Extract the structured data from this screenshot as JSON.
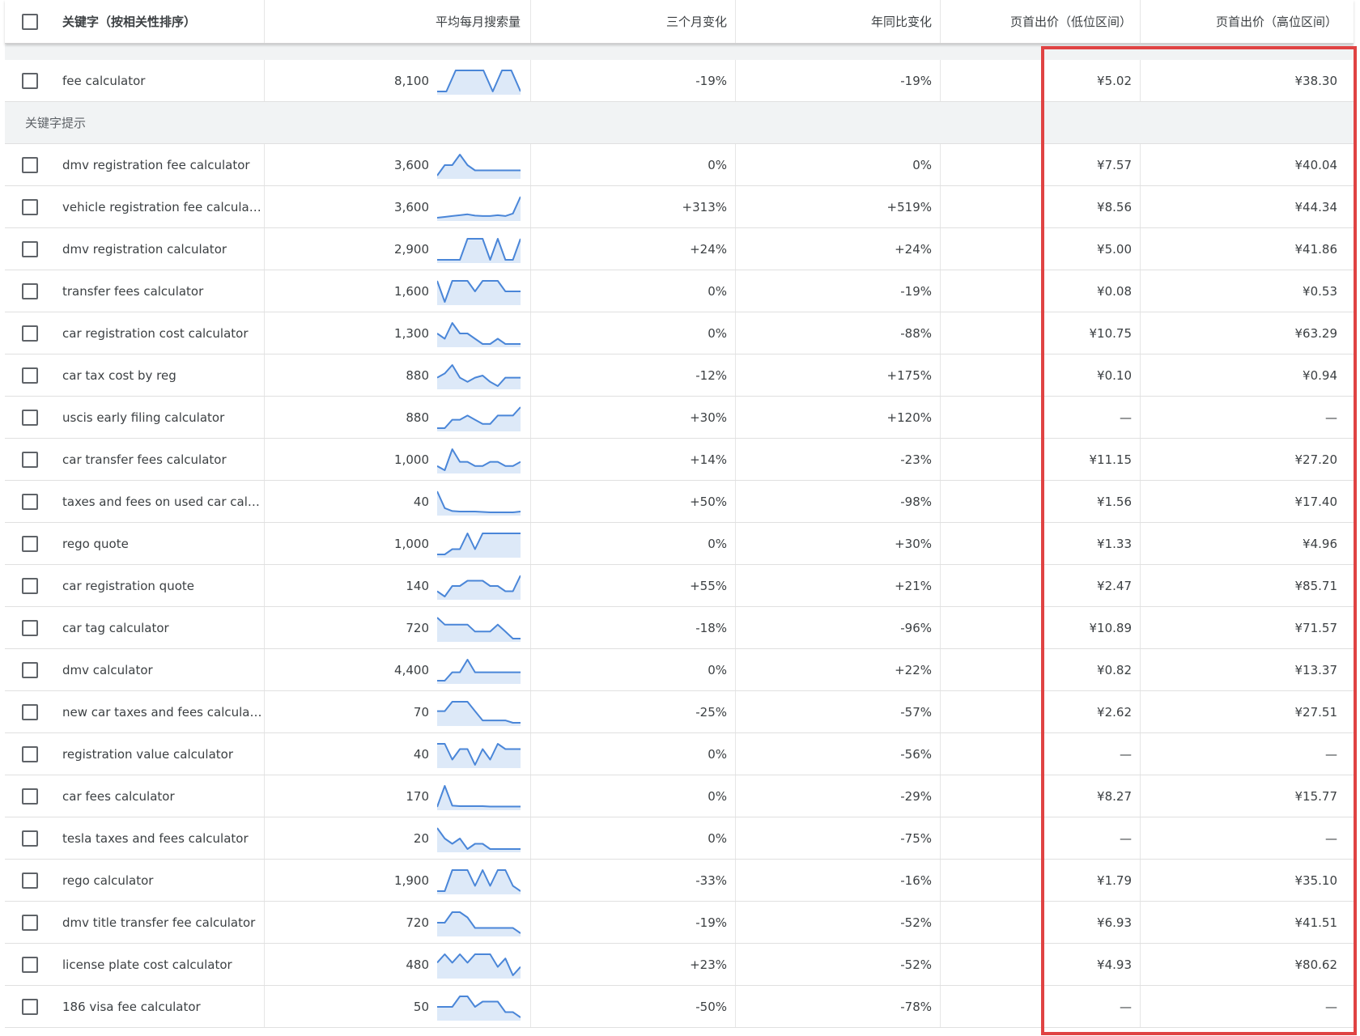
{
  "header": {
    "keyword": "关键字（按相关性排序）",
    "avg_monthly": "平均每月搜索量",
    "three_month": "三个月变化",
    "yoy": "年同比变化",
    "bid_low": "页首出价（低位区间）",
    "bid_high": "页首出价（高位区间）"
  },
  "provided": [
    {
      "keyword": "fee calculator",
      "volume": "8,100",
      "trend": [
        1,
        1,
        6,
        6,
        6,
        6,
        1,
        6,
        6,
        1
      ],
      "three_month": "-19%",
      "yoy": "-19%",
      "bid_low": "¥5.02",
      "bid_high": "¥38.30"
    }
  ],
  "section_label": "关键字提示",
  "rows": [
    {
      "keyword": "dmv registration fee calculator",
      "volume": "3,600",
      "trend": [
        1,
        3,
        3,
        5,
        3,
        2,
        2,
        2,
        2,
        2,
        2,
        2
      ],
      "three_month": "0%",
      "yoy": "0%",
      "bid_low": "¥7.57",
      "bid_high": "¥40.04"
    },
    {
      "keyword": "vehicle registration fee calculator",
      "volume": "3,600",
      "trend": [
        1,
        1.2,
        1.4,
        1.6,
        1.8,
        1.5,
        1.4,
        1.4,
        1.6,
        1.4,
        2,
        6
      ],
      "three_month": "+313%",
      "yoy": "+519%",
      "bid_low": "¥8.56",
      "bid_high": "¥44.34"
    },
    {
      "keyword": "dmv registration calculator",
      "volume": "2,900",
      "trend": [
        1,
        1,
        1,
        1,
        6,
        6,
        6,
        1,
        6,
        1,
        1,
        6
      ],
      "three_month": "+24%",
      "yoy": "+24%",
      "bid_low": "¥5.00",
      "bid_high": "¥41.86"
    },
    {
      "keyword": "transfer fees calculator",
      "volume": "1,600",
      "trend": [
        5,
        1,
        5,
        5,
        5,
        3,
        5,
        5,
        5,
        3,
        3,
        3
      ],
      "three_month": "0%",
      "yoy": "-19%",
      "bid_low": "¥0.08",
      "bid_high": "¥0.53"
    },
    {
      "keyword": "car registration cost calculator",
      "volume": "1,300",
      "trend": [
        4,
        3,
        6,
        4,
        4,
        3,
        2,
        2,
        3,
        2,
        2,
        2
      ],
      "three_month": "0%",
      "yoy": "-88%",
      "bid_low": "¥10.75",
      "bid_high": "¥63.29"
    },
    {
      "keyword": "car tax cost by reg",
      "volume": "880",
      "trend": [
        3,
        4,
        6,
        3,
        2,
        3,
        3.5,
        2,
        1,
        3,
        3,
        3
      ],
      "three_month": "-12%",
      "yoy": "+175%",
      "bid_low": "¥0.10",
      "bid_high": "¥0.94"
    },
    {
      "keyword": "uscis early filing calculator",
      "volume": "880",
      "trend": [
        1,
        1,
        3,
        3,
        4,
        3,
        2,
        2,
        4,
        4,
        4,
        6
      ],
      "three_month": "+30%",
      "yoy": "+120%",
      "bid_low": "—",
      "bid_high": "—"
    },
    {
      "keyword": "car transfer fees calculator",
      "volume": "1,000",
      "trend": [
        2,
        1,
        6,
        3,
        3,
        2,
        2,
        3,
        3,
        2,
        2,
        3
      ],
      "three_month": "+14%",
      "yoy": "-23%",
      "bid_low": "¥11.15",
      "bid_high": "¥27.20"
    },
    {
      "keyword": "taxes and fees on used car calc...",
      "volume": "40",
      "trend": [
        6,
        2,
        1.3,
        1.2,
        1.2,
        1.2,
        1.1,
        1,
        1,
        1,
        1,
        1.2
      ],
      "three_month": "+50%",
      "yoy": "-98%",
      "bid_low": "¥1.56",
      "bid_high": "¥17.40"
    },
    {
      "keyword": "rego quote",
      "volume": "1,000",
      "trend": [
        1,
        1,
        2,
        2,
        5,
        2,
        5,
        5,
        5,
        5,
        5,
        5
      ],
      "three_month": "0%",
      "yoy": "+30%",
      "bid_low": "¥1.33",
      "bid_high": "¥4.96"
    },
    {
      "keyword": "car registration quote",
      "volume": "140",
      "trend": [
        2,
        1,
        3,
        3,
        4,
        4,
        4,
        3,
        3,
        2,
        2,
        5
      ],
      "three_month": "+55%",
      "yoy": "+21%",
      "bid_low": "¥2.47",
      "bid_high": "¥85.71"
    },
    {
      "keyword": "car tag calculator",
      "volume": "720",
      "trend": [
        6,
        5,
        5,
        5,
        5,
        4,
        4,
        4,
        5,
        4,
        3,
        3
      ],
      "three_month": "-18%",
      "yoy": "-96%",
      "bid_low": "¥10.89",
      "bid_high": "¥71.57"
    },
    {
      "keyword": "dmv calculator",
      "volume": "4,400",
      "trend": [
        1,
        1,
        3,
        3,
        6,
        3,
        3,
        3,
        3,
        3,
        3,
        3
      ],
      "three_month": "0%",
      "yoy": "+22%",
      "bid_low": "¥0.82",
      "bid_high": "¥13.37"
    },
    {
      "keyword": "new car taxes and fees calculator",
      "volume": "70",
      "trend": [
        4,
        4,
        6,
        6,
        6,
        4,
        2,
        2,
        2,
        2,
        1.5,
        1.5
      ],
      "three_month": "-25%",
      "yoy": "-57%",
      "bid_low": "¥2.62",
      "bid_high": "¥27.51"
    },
    {
      "keyword": "registration value calculator",
      "volume": "40",
      "trend": [
        5,
        5,
        2,
        4,
        4,
        1,
        4,
        2,
        5,
        4,
        4,
        4
      ],
      "three_month": "0%",
      "yoy": "-56%",
      "bid_low": "—",
      "bid_high": "—"
    },
    {
      "keyword": "car fees calculator",
      "volume": "170",
      "trend": [
        1,
        6,
        1.3,
        1.2,
        1.2,
        1.2,
        1.2,
        1.1,
        1.1,
        1.1,
        1.1,
        1.1
      ],
      "three_month": "0%",
      "yoy": "-29%",
      "bid_low": "¥8.27",
      "bid_high": "¥15.77"
    },
    {
      "keyword": "tesla taxes and fees calculator",
      "volume": "20",
      "trend": [
        5,
        3,
        2,
        3,
        1,
        2,
        2,
        1,
        1,
        1,
        1,
        1
      ],
      "three_month": "0%",
      "yoy": "-75%",
      "bid_low": "—",
      "bid_high": "—"
    },
    {
      "keyword": "rego calculator",
      "volume": "1,900",
      "trend": [
        1,
        1,
        5,
        5,
        5,
        2,
        5,
        2,
        5,
        5,
        2,
        1
      ],
      "three_month": "-33%",
      "yoy": "-16%",
      "bid_low": "¥1.79",
      "bid_high": "¥35.10"
    },
    {
      "keyword": "dmv title transfer fee calculator",
      "volume": "720",
      "trend": [
        3,
        3,
        5,
        5,
        4,
        2,
        2,
        2,
        2,
        2,
        2,
        1
      ],
      "three_month": "-19%",
      "yoy": "-52%",
      "bid_low": "¥6.93",
      "bid_high": "¥41.51"
    },
    {
      "keyword": "license plate cost calculator",
      "volume": "480",
      "trend": [
        4,
        6,
        4,
        6,
        4,
        6,
        6,
        6,
        3,
        5,
        1,
        3
      ],
      "three_month": "+23%",
      "yoy": "-52%",
      "bid_low": "¥4.93",
      "bid_high": "¥80.62"
    },
    {
      "keyword": "186 visa fee calculator",
      "volume": "50",
      "trend": [
        3,
        3,
        3,
        5,
        5,
        3,
        4,
        4,
        4,
        2,
        2,
        1
      ],
      "three_month": "-50%",
      "yoy": "-78%",
      "bid_low": "—",
      "bid_high": "—"
    }
  ],
  "colors": {
    "sparkline_line": "#4a86d8",
    "sparkline_fill": "#dde9f8",
    "highlight_border": "#e04343"
  }
}
